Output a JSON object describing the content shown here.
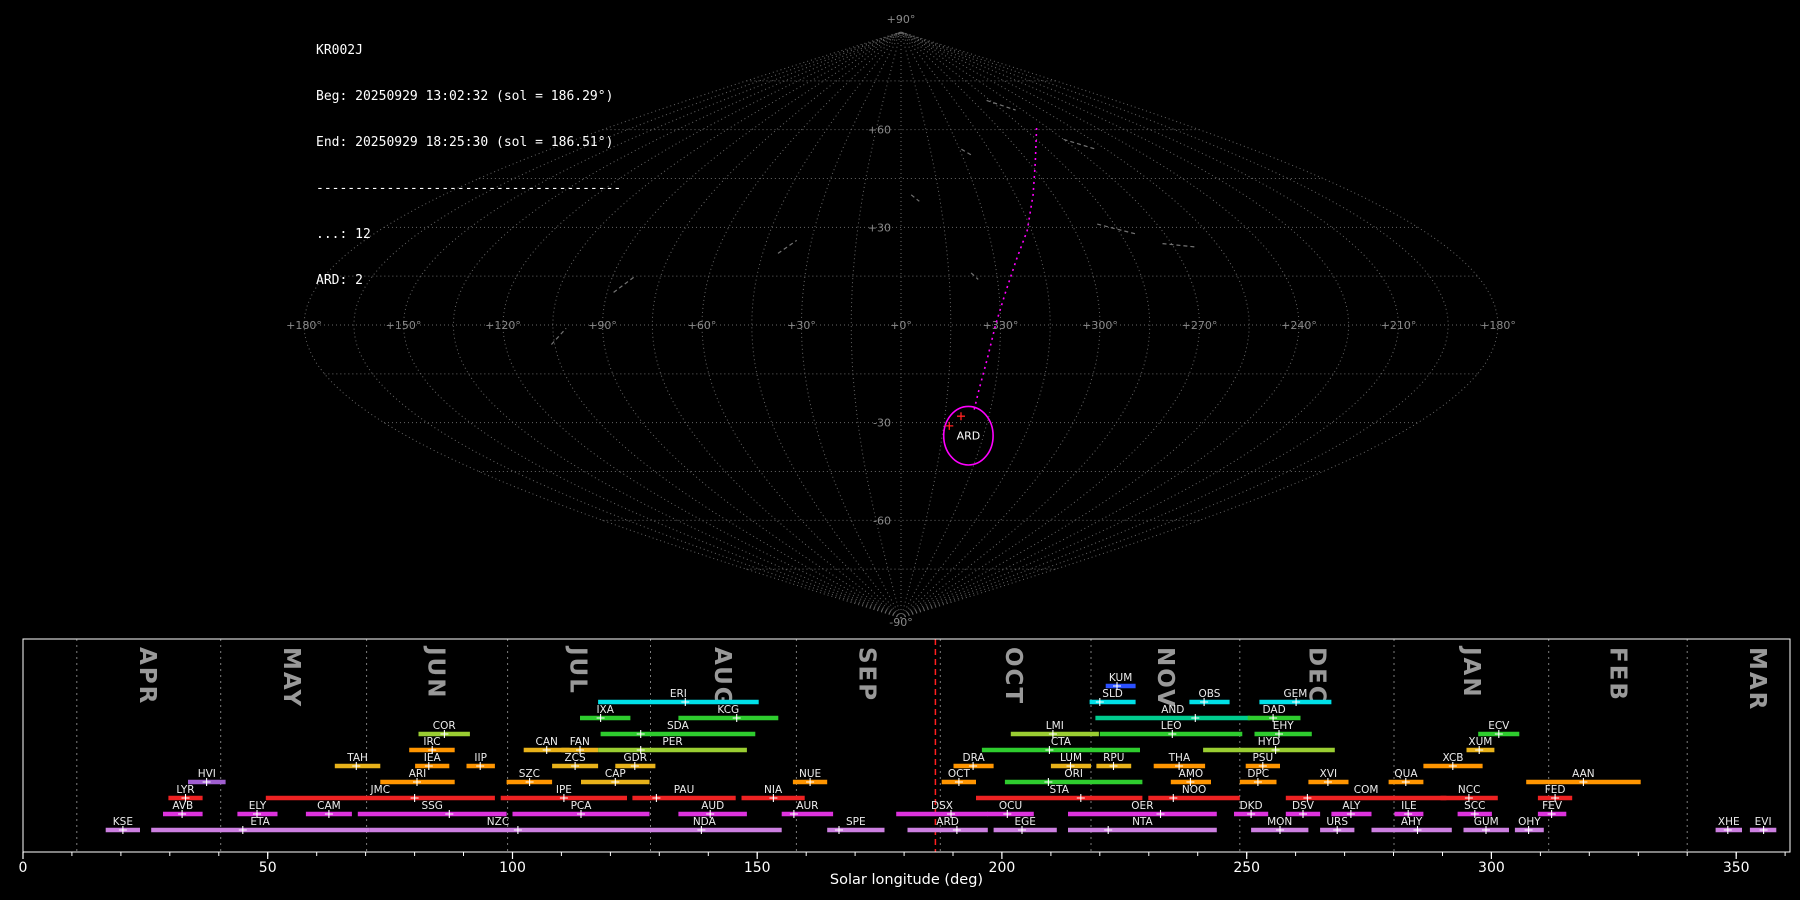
{
  "info_panel": {
    "lines": [
      "KR002J",
      "Beg: 20250929 13:02:32 (sol = 186.29°)",
      "End: 20250929 18:25:30 (sol = 186.51°)",
      "---------------------------------------",
      "...: 12",
      "ARD: 2"
    ]
  },
  "skymap": {
    "grid": {
      "step_deg": 15,
      "color": "#676767"
    },
    "pole_labels": {
      "top": "+90°",
      "bottom": "-90°"
    },
    "lat_labels": [
      {
        "lat": 60,
        "text": "+60"
      },
      {
        "lat": 30,
        "text": "+30"
      },
      {
        "lat": -30,
        "text": "-30"
      },
      {
        "lat": -60,
        "text": "-60"
      }
    ],
    "equator_labels": [
      {
        "x_deg": -180,
        "label": "+180°"
      },
      {
        "x_deg": -150,
        "label": "+150°"
      },
      {
        "x_deg": -120,
        "label": "+120°"
      },
      {
        "x_deg": -90,
        "label": "+90°"
      },
      {
        "x_deg": -60,
        "label": "+60°"
      },
      {
        "x_deg": -30,
        "label": "+30°"
      },
      {
        "x_deg": 0,
        "label": "+0°"
      },
      {
        "x_deg": 30,
        "label": "+330°"
      },
      {
        "x_deg": 60,
        "label": "+300°"
      },
      {
        "x_deg": 90,
        "label": "+270°"
      },
      {
        "x_deg": 120,
        "label": "+240°"
      },
      {
        "x_deg": 150,
        "label": "+210°"
      },
      {
        "x_deg": 180,
        "label": "+180°"
      }
    ],
    "radiant": {
      "code": "ARD",
      "lon": 335.5,
      "lat": -34,
      "radius_deg": 9,
      "color": "#ff00ff"
    },
    "trajectory": {
      "color": "#ff00ff",
      "points": [
        [
          277,
          60.5
        ],
        [
          297,
          50
        ],
        [
          308,
          40
        ],
        [
          316.5,
          29
        ],
        [
          323,
          20
        ],
        [
          328,
          10
        ],
        [
          331.5,
          0
        ],
        [
          333.5,
          -10
        ],
        [
          335,
          -20
        ],
        [
          335.5,
          -27
        ]
      ]
    },
    "meteor_trails": {
      "color": "#9a9a9a",
      "segments": [
        [
          [
            288,
            69
          ],
          [
            275,
            66
          ]
        ],
        [
          [
            270,
            57
          ],
          [
            260,
            54
          ]
        ],
        [
          [
            329,
            54
          ],
          [
            325,
            52
          ]
        ],
        [
          [
            291,
            31
          ],
          [
            280,
            28
          ]
        ],
        [
          [
            273,
            25
          ],
          [
            263,
            24
          ]
        ],
        [
          [
            338,
            16
          ],
          [
            336,
            14
          ]
        ],
        [
          [
            356,
            40
          ],
          [
            353,
            38
          ]
        ],
        [
          [
            106,
            -6
          ],
          [
            101,
            -1
          ]
        ],
        [
          [
            88,
            10
          ],
          [
            83,
            15
          ]
        ],
        [
          [
            40,
            22
          ],
          [
            35,
            26
          ]
        ]
      ]
    },
    "radiant_meteors": {
      "color": "#ff2222",
      "points": [
        [
          343,
          -31
        ],
        [
          339.5,
          -28
        ]
      ]
    }
  },
  "chart_data": {
    "type": "timeline",
    "xlabel": "Solar longitude (deg)",
    "x_range": [
      0,
      361
    ],
    "x_ticks": [
      0,
      50,
      100,
      150,
      200,
      250,
      300,
      350
    ],
    "minor_tick_step": 10,
    "current_sol": 186.4,
    "current_sol_color": "#ff2020",
    "months": [
      {
        "label": "APR",
        "start_sol": 11.0,
        "mid_sol": 25.5
      },
      {
        "label": "MAY",
        "start_sol": 40.4,
        "mid_sol": 55.0
      },
      {
        "label": "JUN",
        "start_sol": 70.2,
        "mid_sol": 84.5
      },
      {
        "label": "JUL",
        "start_sol": 99.0,
        "mid_sol": 113.5
      },
      {
        "label": "AUG",
        "start_sol": 128.2,
        "mid_sol": 143.0
      },
      {
        "label": "SEP",
        "start_sol": 158.0,
        "mid_sol": 172.5
      },
      {
        "label": "OCT",
        "start_sol": 187.4,
        "mid_sol": 202.5
      },
      {
        "label": "NOV",
        "start_sol": 218.2,
        "mid_sol": 233.5
      },
      {
        "label": "DEC",
        "start_sol": 248.6,
        "mid_sol": 264.5
      },
      {
        "label": "JAN",
        "start_sol": 280.1,
        "mid_sol": 296.0
      },
      {
        "label": "FEB",
        "start_sol": 311.7,
        "mid_sol": 326.0
      },
      {
        "label": "MAR",
        "start_sol": 340.0,
        "mid_sol": 354.5
      }
    ],
    "palette": {
      "cyan": "#00e0e8",
      "blue": "#2b50ff",
      "green": "#2ecc2e",
      "teal": "#00cc8f",
      "yellowgreen": "#9acd32",
      "gold": "#e8b21a",
      "orange": "#ff9500",
      "violet": "#a05fd0",
      "red": "#ee2222",
      "magenta": "#dd33dd",
      "plum": "#cc7fe0"
    },
    "showers": [
      {
        "code": "KUM",
        "row": 0,
        "start": 221.2,
        "end": 227.3,
        "peak": 223.5,
        "color": "blue"
      },
      {
        "code": "ERI",
        "row": 1,
        "start": 117.5,
        "end": 150.3,
        "peak": 135.3,
        "color": "cyan"
      },
      {
        "code": "SLD",
        "row": 1,
        "start": 217.9,
        "end": 227.3,
        "peak": 220.0,
        "color": "cyan"
      },
      {
        "code": "OBS",
        "row": 1,
        "start": 238.3,
        "end": 246.5,
        "peak": 241.3,
        "color": "cyan"
      },
      {
        "code": "GEM",
        "row": 1,
        "start": 252.6,
        "end": 267.3,
        "peak": 260.1,
        "color": "cyan"
      },
      {
        "code": "IXA",
        "row": 2,
        "start": 113.8,
        "end": 124.1,
        "peak": 118.0,
        "color": "green"
      },
      {
        "code": "KCG",
        "row": 2,
        "start": 133.9,
        "end": 154.3,
        "peak": 145.8,
        "color": "green"
      },
      {
        "code": "AND",
        "row": 2,
        "start": 219.1,
        "end": 250.7,
        "peak": 239.5,
        "color": "teal"
      },
      {
        "code": "DAD",
        "row": 2,
        "start": 250.2,
        "end": 261.0,
        "peak": 255.4,
        "color": "green"
      },
      {
        "code": "COR",
        "row": 3,
        "start": 80.8,
        "end": 91.3,
        "peak": 86.1,
        "color": "yellowgreen"
      },
      {
        "code": "SDA",
        "row": 3,
        "start": 118.0,
        "end": 149.6,
        "peak": 126.2,
        "color": "green"
      },
      {
        "code": "LMI",
        "row": 3,
        "start": 201.8,
        "end": 219.8,
        "peak": 210.4,
        "color": "yellowgreen"
      },
      {
        "code": "LEO",
        "row": 3,
        "start": 220.0,
        "end": 249.1,
        "peak": 234.8,
        "color": "green"
      },
      {
        "code": "EHY",
        "row": 3,
        "start": 251.6,
        "end": 263.3,
        "peak": 256.6,
        "color": "green"
      },
      {
        "code": "ECV",
        "row": 3,
        "start": 297.3,
        "end": 305.7,
        "peak": 301.5,
        "color": "green"
      },
      {
        "code": "IRC",
        "row": 4,
        "start": 78.9,
        "end": 88.2,
        "peak": 83.6,
        "color": "orange"
      },
      {
        "code": "CAN",
        "row": 4,
        "start": 102.3,
        "end": 111.7,
        "peak": 107.0,
        "color": "gold"
      },
      {
        "code": "FAN",
        "row": 4,
        "start": 110.0,
        "end": 117.5,
        "peak": 113.8,
        "color": "gold"
      },
      {
        "code": "PER",
        "row": 4,
        "start": 117.5,
        "end": 147.9,
        "peak": 126.2,
        "color": "yellowgreen"
      },
      {
        "code": "CTA",
        "row": 4,
        "start": 195.9,
        "end": 228.2,
        "peak": 209.7,
        "color": "green"
      },
      {
        "code": "HYD",
        "row": 4,
        "start": 241.1,
        "end": 268.0,
        "peak": 255.9,
        "color": "yellowgreen"
      },
      {
        "code": "XUM",
        "row": 4,
        "start": 294.9,
        "end": 300.6,
        "peak": 297.5,
        "color": "gold"
      },
      {
        "code": "TAH",
        "row": 5,
        "start": 63.7,
        "end": 73.0,
        "peak": 68.1,
        "color": "gold"
      },
      {
        "code": "IEA",
        "row": 5,
        "start": 80.1,
        "end": 87.1,
        "peak": 82.9,
        "color": "orange"
      },
      {
        "code": "IIP",
        "row": 5,
        "start": 90.6,
        "end": 96.4,
        "peak": 93.4,
        "color": "orange"
      },
      {
        "code": "ZCS",
        "row": 5,
        "start": 108.1,
        "end": 117.5,
        "peak": 112.8,
        "color": "gold"
      },
      {
        "code": "GDR",
        "row": 5,
        "start": 121.0,
        "end": 129.2,
        "peak": 125.0,
        "color": "gold"
      },
      {
        "code": "DRA",
        "row": 5,
        "start": 190.1,
        "end": 198.3,
        "peak": 194.1,
        "color": "orange"
      },
      {
        "code": "LUM",
        "row": 5,
        "start": 210.0,
        "end": 218.2,
        "peak": 214.0,
        "color": "gold"
      },
      {
        "code": "RPU",
        "row": 5,
        "start": 219.3,
        "end": 226.4,
        "peak": 222.8,
        "color": "gold"
      },
      {
        "code": "THA",
        "row": 5,
        "start": 231.0,
        "end": 241.5,
        "peak": 236.2,
        "color": "orange"
      },
      {
        "code": "PSU",
        "row": 5,
        "start": 249.8,
        "end": 256.8,
        "peak": 253.3,
        "color": "orange"
      },
      {
        "code": "XCB",
        "row": 5,
        "start": 286.1,
        "end": 298.2,
        "peak": 292.1,
        "color": "orange"
      },
      {
        "code": "HVI",
        "row": 6,
        "start": 33.7,
        "end": 41.4,
        "peak": 37.5,
        "color": "violet"
      },
      {
        "code": "ARI",
        "row": 6,
        "start": 73.0,
        "end": 88.2,
        "peak": 80.5,
        "color": "orange"
      },
      {
        "code": "SZC",
        "row": 6,
        "start": 98.8,
        "end": 108.1,
        "peak": 103.5,
        "color": "orange"
      },
      {
        "code": "CAP",
        "row": 6,
        "start": 114.0,
        "end": 128.0,
        "peak": 121.0,
        "color": "gold"
      },
      {
        "code": "NUE",
        "row": 6,
        "start": 157.3,
        "end": 164.3,
        "peak": 160.8,
        "color": "orange"
      },
      {
        "code": "OCT",
        "row": 6,
        "start": 187.7,
        "end": 194.7,
        "peak": 191.2,
        "color": "orange"
      },
      {
        "code": "ORI",
        "row": 6,
        "start": 200.6,
        "end": 228.7,
        "peak": 209.5,
        "color": "green"
      },
      {
        "code": "AMO",
        "row": 6,
        "start": 234.5,
        "end": 242.7,
        "peak": 238.5,
        "color": "orange"
      },
      {
        "code": "DPC",
        "row": 6,
        "start": 248.6,
        "end": 256.1,
        "peak": 252.3,
        "color": "orange"
      },
      {
        "code": "XVI",
        "row": 6,
        "start": 262.6,
        "end": 270.8,
        "peak": 266.6,
        "color": "orange"
      },
      {
        "code": "QUA",
        "row": 6,
        "start": 279.0,
        "end": 286.1,
        "peak": 282.5,
        "color": "orange"
      },
      {
        "code": "AAN",
        "row": 6,
        "start": 307.1,
        "end": 330.5,
        "peak": 318.8,
        "color": "orange"
      },
      {
        "code": "LYR",
        "row": 7,
        "start": 29.7,
        "end": 36.7,
        "peak": 33.2,
        "color": "red"
      },
      {
        "code": "JMC",
        "row": 7,
        "start": 49.6,
        "end": 96.4,
        "peak": 80.0,
        "color": "red"
      },
      {
        "code": "IPE",
        "row": 7,
        "start": 97.6,
        "end": 123.4,
        "peak": 110.5,
        "color": "red"
      },
      {
        "code": "PAU",
        "row": 7,
        "start": 124.5,
        "end": 145.6,
        "peak": 129.4,
        "color": "red"
      },
      {
        "code": "NIA",
        "row": 7,
        "start": 146.8,
        "end": 159.7,
        "peak": 153.3,
        "color": "red"
      },
      {
        "code": "STA",
        "row": 7,
        "start": 194.7,
        "end": 228.7,
        "peak": 216.1,
        "color": "red"
      },
      {
        "code": "NOO",
        "row": 7,
        "start": 229.9,
        "end": 248.6,
        "peak": 235.0,
        "color": "red"
      },
      {
        "code": "COM",
        "row": 7,
        "start": 258.0,
        "end": 290.8,
        "peak": 262.4,
        "color": "red"
      },
      {
        "code": "NCC",
        "row": 7,
        "start": 289.6,
        "end": 301.3,
        "peak": 295.4,
        "color": "red"
      },
      {
        "code": "FED",
        "row": 7,
        "start": 309.5,
        "end": 316.5,
        "peak": 313.0,
        "color": "red"
      },
      {
        "code": "AVB",
        "row": 8,
        "start": 28.6,
        "end": 36.7,
        "peak": 32.5,
        "color": "magenta"
      },
      {
        "code": "ELY",
        "row": 8,
        "start": 43.8,
        "end": 52.0,
        "peak": 47.8,
        "color": "magenta"
      },
      {
        "code": "CAM",
        "row": 8,
        "start": 57.8,
        "end": 67.2,
        "peak": 62.5,
        "color": "magenta"
      },
      {
        "code": "SSG",
        "row": 8,
        "start": 68.4,
        "end": 98.8,
        "peak": 87.1,
        "color": "magenta"
      },
      {
        "code": "PCA",
        "row": 8,
        "start": 100.0,
        "end": 128.0,
        "peak": 114.0,
        "color": "magenta"
      },
      {
        "code": "AUD",
        "row": 8,
        "start": 133.9,
        "end": 147.9,
        "peak": 140.4,
        "color": "magenta"
      },
      {
        "code": "AUR",
        "row": 8,
        "start": 155.0,
        "end": 165.5,
        "peak": 157.5,
        "color": "magenta"
      },
      {
        "code": "DSX",
        "row": 8,
        "start": 178.4,
        "end": 197.1,
        "peak": 189.6,
        "color": "magenta"
      },
      {
        "code": "OCU",
        "row": 8,
        "start": 197.0,
        "end": 206.5,
        "peak": 201.1,
        "color": "magenta"
      },
      {
        "code": "OER",
        "row": 8,
        "start": 213.5,
        "end": 243.9,
        "peak": 232.4,
        "color": "magenta"
      },
      {
        "code": "DKD",
        "row": 8,
        "start": 247.4,
        "end": 254.4,
        "peak": 250.9,
        "color": "magenta"
      },
      {
        "code": "DSV",
        "row": 8,
        "start": 258.0,
        "end": 265.0,
        "peak": 261.5,
        "color": "magenta"
      },
      {
        "code": "ALY",
        "row": 8,
        "start": 267.3,
        "end": 275.5,
        "peak": 271.3,
        "color": "magenta"
      },
      {
        "code": "ILE",
        "row": 8,
        "start": 280.2,
        "end": 286.1,
        "peak": 283.0,
        "color": "magenta"
      },
      {
        "code": "SCC",
        "row": 8,
        "start": 293.1,
        "end": 300.1,
        "peak": 296.6,
        "color": "magenta"
      },
      {
        "code": "FEV",
        "row": 8,
        "start": 309.5,
        "end": 315.3,
        "peak": 312.3,
        "color": "magenta"
      },
      {
        "code": "KSE",
        "row": 9,
        "start": 16.9,
        "end": 23.9,
        "peak": 20.4,
        "color": "plum"
      },
      {
        "code": "ETA",
        "row": 9,
        "start": 26.2,
        "end": 70.7,
        "peak": 44.9,
        "color": "plum"
      },
      {
        "code": "NZC",
        "row": 9,
        "start": 70.7,
        "end": 123.4,
        "peak": 101.1,
        "color": "plum"
      },
      {
        "code": "NDA",
        "row": 9,
        "start": 123.4,
        "end": 155.0,
        "peak": 138.6,
        "color": "plum"
      },
      {
        "code": "SPE",
        "row": 9,
        "start": 164.3,
        "end": 176.0,
        "peak": 166.7,
        "color": "plum"
      },
      {
        "code": "ARD",
        "row": 9,
        "start": 180.7,
        "end": 197.1,
        "peak": 190.8,
        "color": "plum"
      },
      {
        "code": "EGE",
        "row": 9,
        "start": 198.3,
        "end": 211.2,
        "peak": 204.1,
        "color": "plum"
      },
      {
        "code": "NTA",
        "row": 9,
        "start": 213.5,
        "end": 243.9,
        "peak": 221.7,
        "color": "plum"
      },
      {
        "code": "MON",
        "row": 9,
        "start": 250.9,
        "end": 262.6,
        "peak": 256.8,
        "color": "plum"
      },
      {
        "code": "URS",
        "row": 9,
        "start": 265.0,
        "end": 272.0,
        "peak": 268.5,
        "color": "plum"
      },
      {
        "code": "AHY",
        "row": 9,
        "start": 275.5,
        "end": 291.9,
        "peak": 284.9,
        "color": "plum"
      },
      {
        "code": "GUM",
        "row": 9,
        "start": 294.3,
        "end": 303.6,
        "peak": 298.9,
        "color": "plum"
      },
      {
        "code": "OHY",
        "row": 9,
        "start": 304.8,
        "end": 310.7,
        "peak": 307.6,
        "color": "plum"
      },
      {
        "code": "XHE",
        "row": 9,
        "start": 345.8,
        "end": 351.2,
        "peak": 348.3,
        "color": "plum"
      },
      {
        "code": "EVI",
        "row": 9,
        "start": 352.8,
        "end": 358.2,
        "peak": 355.6,
        "color": "plum"
      }
    ]
  }
}
